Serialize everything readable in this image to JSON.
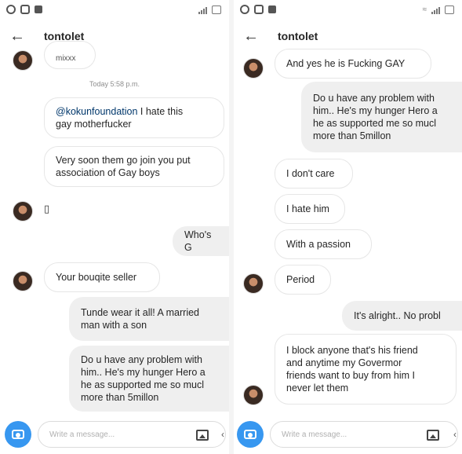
{
  "left": {
    "title": "tontolet",
    "top_partial_text": "mixxx",
    "timestamp": "Today 5:58 p.m.",
    "mention": "@kokunfoundation",
    "mention_rest": " I hate this\ngay motherfucker",
    "msg_soon": "Very soon them go join you put\nassociation of Gay boys",
    "box_char": "▯",
    "msg_whos": "Who's G",
    "msg_bouqite": "Your bouqite seller",
    "msg_tunde": "Tunde wear it all!  A married\nman with a son",
    "msg_problem": "Do u have any problem with\nhim.. He's my hunger Hero a\nhe as supported me so mucl\nmore than 5millon",
    "composer_placeholder": "Write a message..."
  },
  "right": {
    "title": "tontolet",
    "msg_gay": "And yes he is Fucking GAY",
    "msg_problem": "Do u have any problem with\nhim.. He's my hunger Hero a\nhe as supported me so mucl\nmore than 5millon",
    "msg_dont_care": "I don't care",
    "msg_hate": "I hate him",
    "msg_passion": "With a passion",
    "msg_period": "Period",
    "msg_alright": "It's alright.. No probl",
    "msg_block": "I block anyone that's his friend\nand anytime my Govermor\nfriends want to buy from him I\nnever let them",
    "composer_placeholder": "Write a message..."
  },
  "icons": {
    "back": "arrow-left-icon",
    "camera": "camera-icon",
    "gallery": "image-icon",
    "accent_color": "#3797f0"
  }
}
